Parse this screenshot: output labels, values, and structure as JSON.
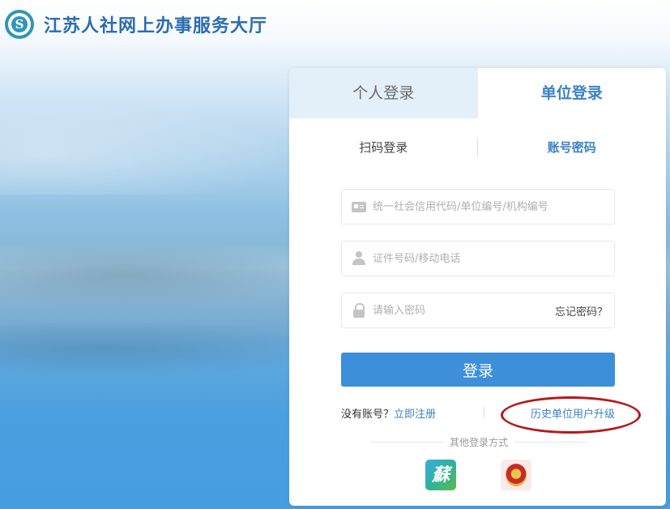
{
  "header": {
    "logo_letter": "S",
    "title": "江苏人社网上办事服务大厅"
  },
  "tabs": {
    "personal": "个人登录",
    "unit": "单位登录",
    "active": "unit"
  },
  "subtabs": {
    "qr": "扫码登录",
    "password": "账号密码",
    "active": "password"
  },
  "form": {
    "unit_id_placeholder": "统一社会信用代码/单位编号/机构编号",
    "id_phone_placeholder": "证件号码/移动电话",
    "password_placeholder": "请输入密码",
    "forgot_password": "忘记密码？",
    "login_button": "登录"
  },
  "register": {
    "no_account": "没有账号？",
    "register_now": "立即注册",
    "history_upgrade": "历史单位用户升级"
  },
  "other_login": {
    "label": "其他登录方式",
    "su_icon_char": "蘇",
    "icons": [
      "su-app-icon",
      "national-emblem-icon"
    ]
  },
  "colors": {
    "accent": "#3c82c6",
    "button": "#3d8fd9",
    "annotation": "#b31a1a"
  }
}
